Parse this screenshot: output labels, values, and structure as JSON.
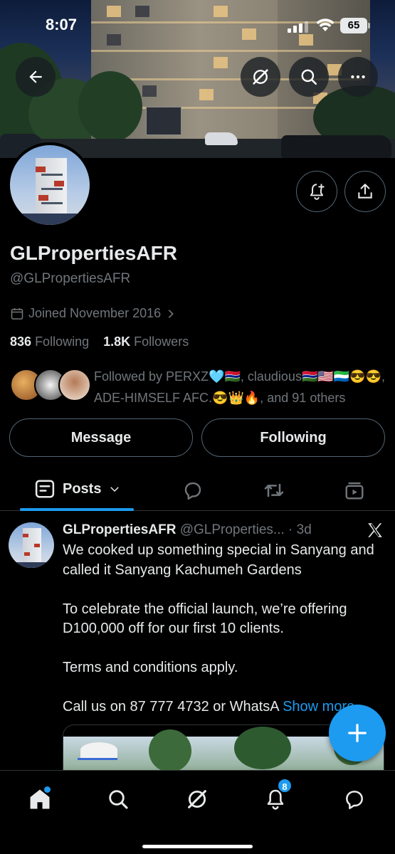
{
  "status_bar": {
    "time": "8:07",
    "battery": "65"
  },
  "profile": {
    "display_name": "GLPropertiesAFR",
    "handle": "@GLPropertiesAFR",
    "joined": "Joined November 2016",
    "following_count": "836",
    "following_label": "Following",
    "followers_count": "1.8K",
    "followers_label": "Followers",
    "followed_by": "Followed by PERXZ🩵🇬🇲, claudious🇬🇲🇺🇸🇸🇱😎😎, ADE-HIMSELF AFC.😎👑🔥, and 91 others"
  },
  "actions": {
    "message_label": "Message",
    "following_label": "Following"
  },
  "tabs": {
    "posts_label": "Posts"
  },
  "tweet": {
    "author": "GLPropertiesAFR",
    "handle_time": "@GLProperties... · 3d",
    "body": "We cooked up something special in Sanyang and called it Sanyang Kachumeh Gardens\n\nTo celebrate the official launch, we’re offering D100,000 off for our first 10 clients.\n\nTerms and conditions apply.\n\nCall us on  87 777 4732 or WhatsA",
    "show_more": "Show more"
  },
  "nav": {
    "notifications_badge": "8"
  },
  "colors": {
    "accent": "#1d9bf0",
    "background": "#000000",
    "muted": "#71767b"
  },
  "icons": [
    "back-arrow-icon",
    "grok-icon",
    "search-icon",
    "more-icon",
    "notify-bell-icon",
    "share-icon",
    "calendar-icon",
    "chevron-right-icon",
    "posts-icon",
    "chevron-down-icon",
    "reply-icon",
    "repost-icon",
    "media-icon",
    "x-logo-icon",
    "plus-icon",
    "home-icon",
    "bell-icon",
    "messages-icon"
  ]
}
